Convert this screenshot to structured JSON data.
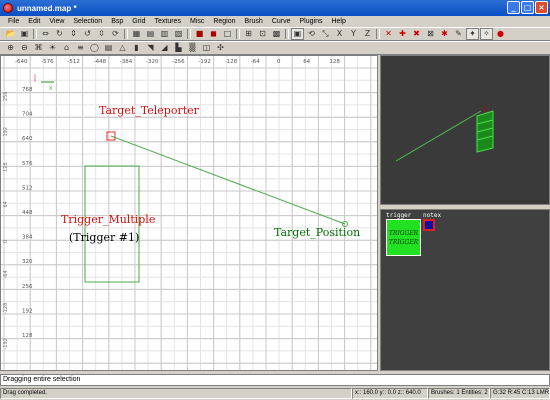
{
  "window": {
    "title": "unnamed.map *",
    "buttons": {
      "minimize": "_",
      "maximize": "□",
      "close": "×"
    }
  },
  "menu": [
    "File",
    "Edit",
    "View",
    "Selection",
    "Bsp",
    "Grid",
    "Textures",
    "Misc",
    "Region",
    "Brush",
    "Curve",
    "Plugins",
    "Help"
  ],
  "grid": {
    "x_ticks": [
      "-640",
      "-576",
      "-512",
      "-448",
      "-384",
      "-320",
      "-256",
      "-192",
      "-128",
      "-64",
      "0",
      "64",
      "128"
    ],
    "y_ticks": [
      "768",
      "704",
      "640",
      "576",
      "512",
      "448",
      "384",
      "320",
      "256",
      "192",
      "128"
    ],
    "left_ticks": [
      "256",
      "192",
      "128",
      "64",
      "0",
      "-64",
      "-128",
      "-192",
      "-256"
    ],
    "axis_marker_letter": "X"
  },
  "annotations": {
    "target_teleporter": "Target_Teleporter",
    "trigger_multiple": "Trigger_Multiple",
    "trigger_number": "(Trigger #1)",
    "target_position": "Target_Position"
  },
  "textures": {
    "trigger_label": "trigger",
    "notex_label": "notex",
    "trigger_swatch_text": "TRIGGER TRIGGER"
  },
  "console": {
    "text": "Dragging entire selection"
  },
  "status": {
    "message": "Drag completed.",
    "coords": "x:: 160.0  y:: 0.0  z:: 640.0",
    "counts": "Brushes: 1 Entities: 2",
    "grid": "G:32 R:45 C:13 LMR"
  },
  "colors": {
    "grid_bg": "#ffffff",
    "grid_minor": "#e4e4e4",
    "grid_major": "#c8c8c8",
    "brush": "#4aa84a",
    "entity_red": "#e03030",
    "camera_bg": "#3a3a3a",
    "trigger_green": "#22e022"
  }
}
